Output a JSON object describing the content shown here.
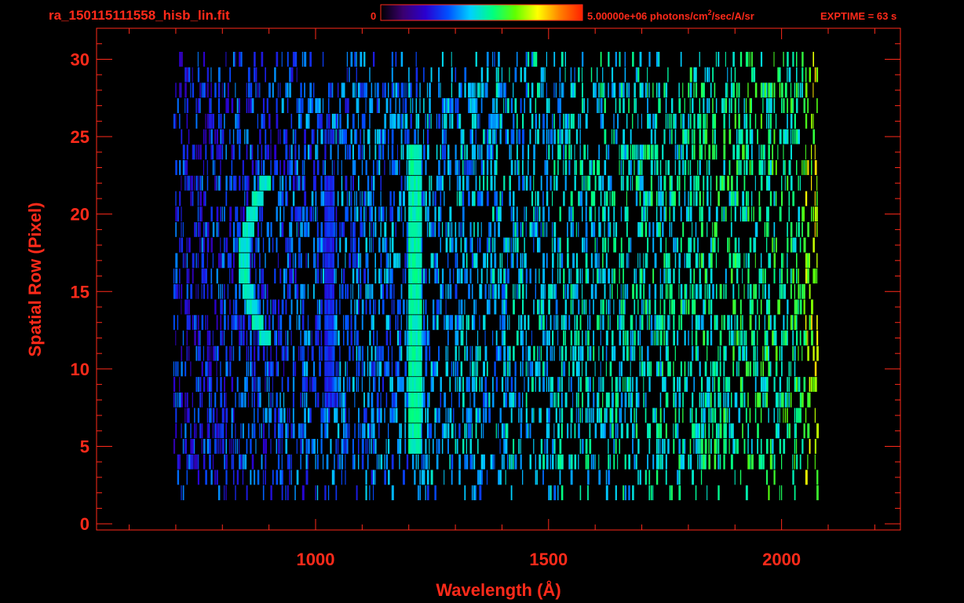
{
  "chart_data": {
    "type": "heatmap",
    "title": "ra_150115111558_hisb_lin.fit",
    "xlabel": "Wavelength (Å)",
    "ylabel": "Spatial Row (Pixel)",
    "xlim": [
      530,
      2255
    ],
    "ylim": [
      -0.4,
      32
    ],
    "x_ticks": [
      1000,
      1500,
      2000
    ],
    "y_ticks": [
      0,
      5,
      10,
      15,
      20,
      25,
      30
    ],
    "colorbar": {
      "min_label": "0",
      "max_label": "5.00000e+06 photons/cm",
      "max_label_sup": "2",
      "max_label_tail": "/sec/A/sr",
      "min_value": 0,
      "max_value": 5000000,
      "colors": [
        "#000000",
        "#3a0070",
        "#2a00d0",
        "#0050ff",
        "#00d0ff",
        "#00ff80",
        "#60ff00",
        "#ffff00",
        "#ff8000",
        "#ff2000"
      ]
    },
    "exposure_label": "EXPTIME = 63 s",
    "data_extent": {
      "x": [
        695,
        2075
      ],
      "rows": [
        2,
        30
      ]
    },
    "features": [
      {
        "description": "curved emission arc",
        "rows": [
          12,
          22
        ],
        "wavelength_center": 845,
        "curvature": 45,
        "level": 0.5
      },
      {
        "description": "bright vertical emission line",
        "rows": [
          5,
          24
        ],
        "wavelength": 1212,
        "level": 0.52
      },
      {
        "description": "faint emission line",
        "rows": [
          8,
          22
        ],
        "wavelength": 1027,
        "level": 0.28
      }
    ]
  }
}
